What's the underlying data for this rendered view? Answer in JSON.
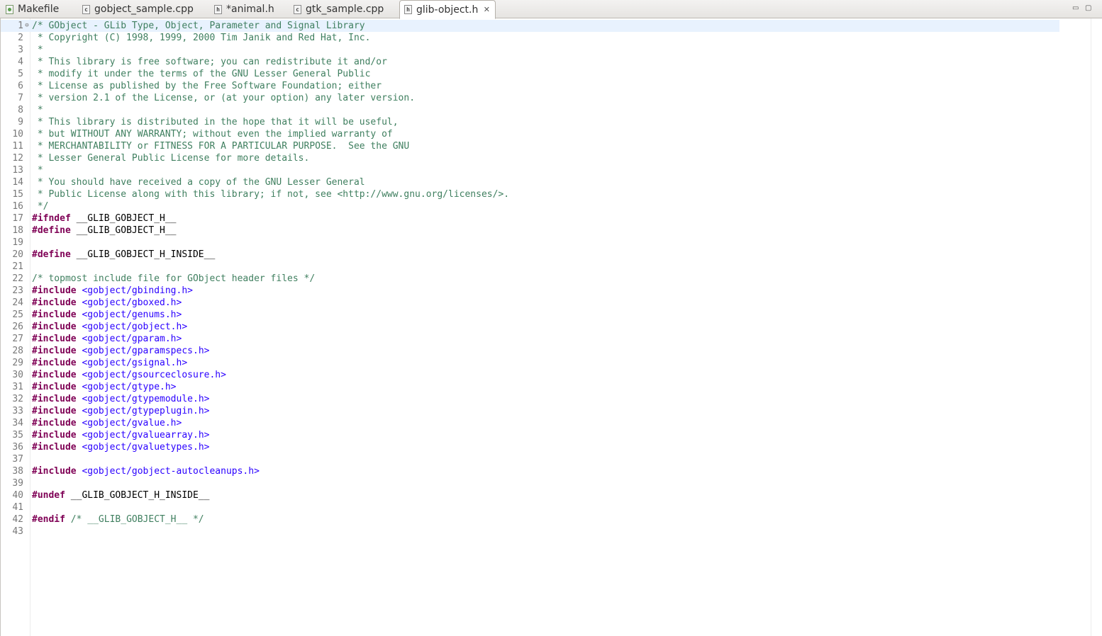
{
  "tabs": [
    {
      "label": "Makefile",
      "icon": "makefile-icon",
      "active": false
    },
    {
      "label": "gobject_sample.cpp",
      "icon": "cpp-file-icon",
      "active": false
    },
    {
      "label": "*animal.h",
      "icon": "header-file-icon",
      "active": false
    },
    {
      "label": "gtk_sample.cpp",
      "icon": "cpp-file-icon",
      "active": false
    },
    {
      "label": "glib-object.h",
      "icon": "header-file-icon",
      "active": true
    }
  ],
  "window_controls": {
    "minimize": "▭",
    "maximize": "▢"
  },
  "colors": {
    "comment": "#3f7f5f",
    "directive": "#7f0055",
    "include_path": "#2a00ff",
    "current_line": "#e8f2fe"
  },
  "lines": [
    [
      [
        "cm",
        "/* GObject - GLib Type, Object, Parameter and Signal Library"
      ]
    ],
    [
      [
        "cm",
        " * Copyright (C) 1998, 1999, 2000 Tim Janik and Red Hat, Inc."
      ]
    ],
    [
      [
        "cm",
        " *"
      ]
    ],
    [
      [
        "cm",
        " * This library is free software; you can redistribute it and/or"
      ]
    ],
    [
      [
        "cm",
        " * modify it under the terms of the GNU Lesser General Public"
      ]
    ],
    [
      [
        "cm",
        " * License as published by the Free Software Foundation; either"
      ]
    ],
    [
      [
        "cm",
        " * version 2.1 of the License, or (at your option) any later version."
      ]
    ],
    [
      [
        "cm",
        " *"
      ]
    ],
    [
      [
        "cm",
        " * This library is distributed in the hope that it will be useful,"
      ]
    ],
    [
      [
        "cm",
        " * but WITHOUT ANY WARRANTY; without even the implied warranty of"
      ]
    ],
    [
      [
        "cm",
        " * MERCHANTABILITY or FITNESS FOR A PARTICULAR PURPOSE.  See the GNU"
      ]
    ],
    [
      [
        "cm",
        " * Lesser General Public License for more details."
      ]
    ],
    [
      [
        "cm",
        " *"
      ]
    ],
    [
      [
        "cm",
        " * You should have received a copy of the GNU Lesser General"
      ]
    ],
    [
      [
        "cm",
        " * Public License along with this library; if not, see <http://www.gnu.org/licenses/>."
      ]
    ],
    [
      [
        "cm",
        " */"
      ]
    ],
    [
      [
        "pp",
        "#ifndef"
      ],
      [
        "plain",
        " __GLIB_GOBJECT_H__"
      ]
    ],
    [
      [
        "pp",
        "#define"
      ],
      [
        "plain",
        " __GLIB_GOBJECT_H__"
      ]
    ],
    [],
    [
      [
        "pp",
        "#define"
      ],
      [
        "plain",
        " __GLIB_GOBJECT_H_INSIDE__"
      ]
    ],
    [],
    [
      [
        "cm",
        "/* topmost include file for GObject header files */"
      ]
    ],
    [
      [
        "pp",
        "#include"
      ],
      [
        "plain",
        " "
      ],
      [
        "inc",
        "<gobject/gbinding.h>"
      ]
    ],
    [
      [
        "pp",
        "#include"
      ],
      [
        "plain",
        " "
      ],
      [
        "inc",
        "<gobject/gboxed.h>"
      ]
    ],
    [
      [
        "pp",
        "#include"
      ],
      [
        "plain",
        " "
      ],
      [
        "inc",
        "<gobject/genums.h>"
      ]
    ],
    [
      [
        "pp",
        "#include"
      ],
      [
        "plain",
        " "
      ],
      [
        "inc",
        "<gobject/gobject.h>"
      ]
    ],
    [
      [
        "pp",
        "#include"
      ],
      [
        "plain",
        " "
      ],
      [
        "inc",
        "<gobject/gparam.h>"
      ]
    ],
    [
      [
        "pp",
        "#include"
      ],
      [
        "plain",
        " "
      ],
      [
        "inc",
        "<gobject/gparamspecs.h>"
      ]
    ],
    [
      [
        "pp",
        "#include"
      ],
      [
        "plain",
        " "
      ],
      [
        "inc",
        "<gobject/gsignal.h>"
      ]
    ],
    [
      [
        "pp",
        "#include"
      ],
      [
        "plain",
        " "
      ],
      [
        "inc",
        "<gobject/gsourceclosure.h>"
      ]
    ],
    [
      [
        "pp",
        "#include"
      ],
      [
        "plain",
        " "
      ],
      [
        "inc",
        "<gobject/gtype.h>"
      ]
    ],
    [
      [
        "pp",
        "#include"
      ],
      [
        "plain",
        " "
      ],
      [
        "inc",
        "<gobject/gtypemodule.h>"
      ]
    ],
    [
      [
        "pp",
        "#include"
      ],
      [
        "plain",
        " "
      ],
      [
        "inc",
        "<gobject/gtypeplugin.h>"
      ]
    ],
    [
      [
        "pp",
        "#include"
      ],
      [
        "plain",
        " "
      ],
      [
        "inc",
        "<gobject/gvalue.h>"
      ]
    ],
    [
      [
        "pp",
        "#include"
      ],
      [
        "plain",
        " "
      ],
      [
        "inc",
        "<gobject/gvaluearray.h>"
      ]
    ],
    [
      [
        "pp",
        "#include"
      ],
      [
        "plain",
        " "
      ],
      [
        "inc",
        "<gobject/gvaluetypes.h>"
      ]
    ],
    [],
    [
      [
        "pp",
        "#include"
      ],
      [
        "plain",
        " "
      ],
      [
        "inc",
        "<gobject/gobject-autocleanups.h>"
      ]
    ],
    [],
    [
      [
        "pp",
        "#undef"
      ],
      [
        "plain",
        " __GLIB_GOBJECT_H_INSIDE__"
      ]
    ],
    [],
    [
      [
        "pp",
        "#endif"
      ],
      [
        "plain",
        " "
      ],
      [
        "cm",
        "/* __GLIB_GOBJECT_H__ */"
      ]
    ],
    []
  ],
  "line_numbers": [
    "1",
    "2",
    "3",
    "4",
    "5",
    "6",
    "7",
    "8",
    "9",
    "10",
    "11",
    "12",
    "13",
    "14",
    "15",
    "16",
    "17",
    "18",
    "19",
    "20",
    "21",
    "22",
    "23",
    "24",
    "25",
    "26",
    "27",
    "28",
    "29",
    "30",
    "31",
    "32",
    "33",
    "34",
    "35",
    "36",
    "37",
    "38",
    "39",
    "40",
    "41",
    "42",
    "43"
  ],
  "fold_marker": "⊖",
  "current_line": 1
}
